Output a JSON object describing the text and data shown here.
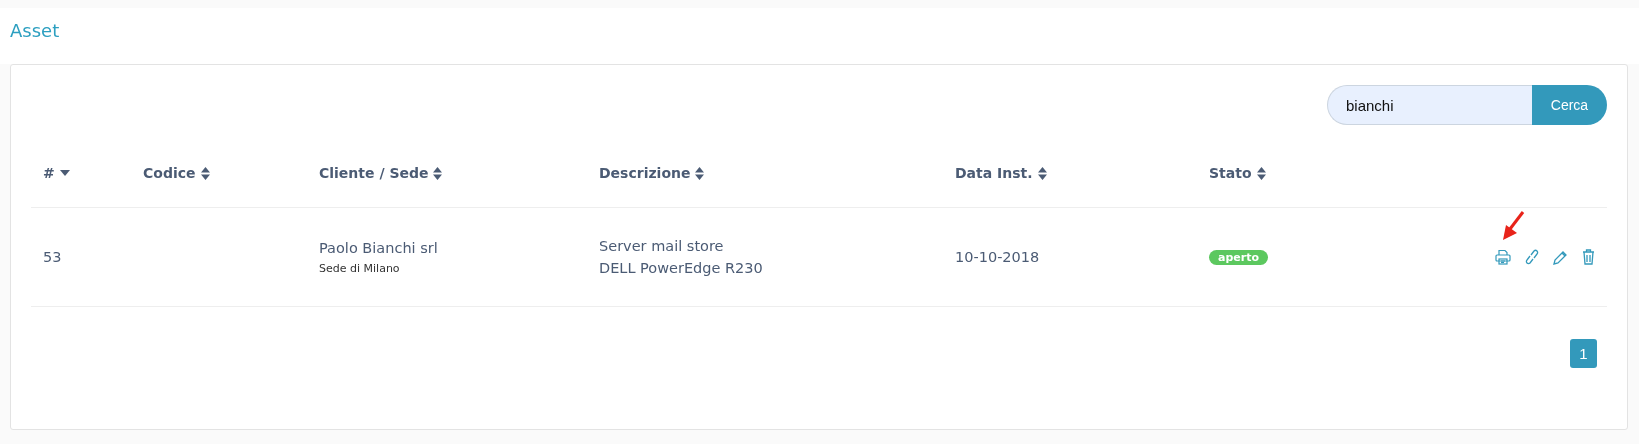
{
  "page": {
    "title": "Asset"
  },
  "search": {
    "value": "bianchi",
    "button": "Cerca"
  },
  "table": {
    "columns": [
      {
        "label": "#",
        "sorted": true
      },
      {
        "label": "Codice",
        "sorted": false
      },
      {
        "label": "Cliente / Sede",
        "sorted": false
      },
      {
        "label": "Descrizione",
        "sorted": false
      },
      {
        "label": "Data Inst.",
        "sorted": false
      },
      {
        "label": "Stato",
        "sorted": false
      }
    ],
    "rows": [
      {
        "id": "53",
        "cliente": "Paolo Bianchi srl",
        "sede": "Sede di Milano",
        "descrizione": [
          "Server mail store",
          "DELL PowerEdge R230"
        ],
        "data": "10-10-2018",
        "stato": "aperto",
        "color": "#5cc85f"
      }
    ]
  },
  "pagination": [
    {
      "label": "1",
      "selected": true
    }
  ],
  "annotation": {
    "arrow_on_print": true
  }
}
